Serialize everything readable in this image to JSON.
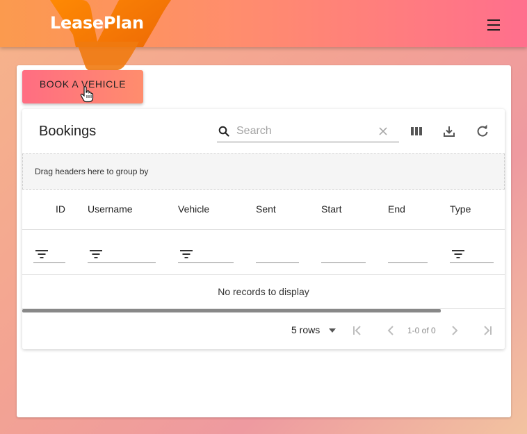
{
  "app": {
    "brand": "LeasePlan",
    "colors": {
      "accent_start": "#ff6d82",
      "accent_end": "#ff8d6d",
      "topbar_orange": "#fb9a4e"
    }
  },
  "header": {
    "menu_icon": "menu-icon"
  },
  "actions": {
    "book_label": "BOOK A VEHICLE"
  },
  "table": {
    "title": "Bookings",
    "search": {
      "placeholder": "Search",
      "value": ""
    },
    "toolbar_icons": [
      "columns-icon",
      "download-icon",
      "refresh-icon"
    ],
    "group_hint": "Drag headers here to group by",
    "columns": [
      "ID",
      "Username",
      "Vehicle",
      "Sent",
      "Start",
      "End",
      "Type"
    ],
    "empty_message": "No records to display",
    "pagination": {
      "rows_per_page": "5 rows",
      "range": "1-0 of 0"
    }
  }
}
